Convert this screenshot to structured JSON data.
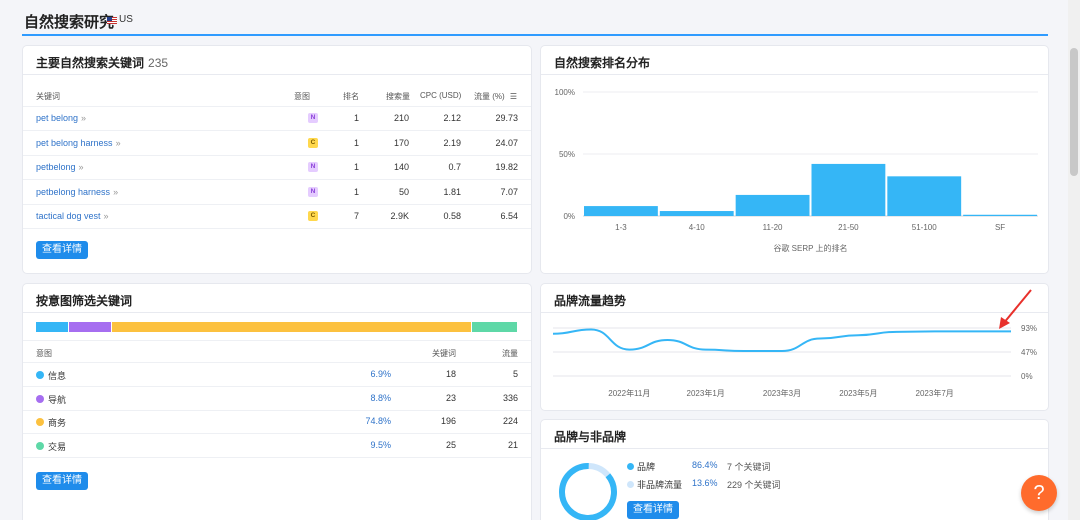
{
  "page": {
    "title": "自然搜索研究",
    "region": "US"
  },
  "keywords_card": {
    "title": "主要自然搜索关键词",
    "count": "235",
    "headers": {
      "keyword": "关键词",
      "intent": "意图",
      "rank": "排名",
      "volume": "搜索量",
      "cpc": "CPC (USD)",
      "traffic": "流量 (%)"
    },
    "rows": [
      {
        "keyword": "pet belong",
        "intent": "N",
        "rank": "1",
        "volume": "210",
        "cpc": "2.12",
        "traffic": "29.73"
      },
      {
        "keyword": "pet belong harness",
        "intent": "C",
        "rank": "1",
        "volume": "170",
        "cpc": "2.19",
        "traffic": "24.07"
      },
      {
        "keyword": "petbelong",
        "intent": "N",
        "rank": "1",
        "volume": "140",
        "cpc": "0.7",
        "traffic": "19.82"
      },
      {
        "keyword": "petbelong harness",
        "intent": "N",
        "rank": "1",
        "volume": "50",
        "cpc": "1.81",
        "traffic": "7.07"
      },
      {
        "keyword": "tactical dog vest",
        "intent": "C",
        "rank": "7",
        "volume": "2.9K",
        "cpc": "0.58",
        "traffic": "6.54"
      }
    ],
    "button": "查看详情"
  },
  "rank_card": {
    "title": "自然搜索排名分布"
  },
  "intent_card": {
    "title": "按意图筛选关键词",
    "headers": {
      "intent": "意图",
      "keywords": "关键词",
      "traffic": "流量"
    },
    "rows": [
      {
        "label": "信息",
        "pct": "6.9%",
        "pct_value": 6.9,
        "keywords": "18",
        "traffic": "5",
        "color": "#35b6f6"
      },
      {
        "label": "导航",
        "pct": "8.8%",
        "pct_value": 8.8,
        "keywords": "23",
        "traffic": "336",
        "color": "#a66ef0"
      },
      {
        "label": "商务",
        "pct": "74.8%",
        "pct_value": 74.8,
        "keywords": "196",
        "traffic": "224",
        "color": "#fcc13f"
      },
      {
        "label": "交易",
        "pct": "9.5%",
        "pct_value": 9.5,
        "keywords": "25",
        "traffic": "21",
        "color": "#5ed8a7"
      }
    ],
    "button": "查看详情"
  },
  "trend_card": {
    "title": "品牌流量趋势"
  },
  "brand_card": {
    "title": "品牌与非品牌",
    "brand": {
      "label": "品牌",
      "pct": "86.4%",
      "pct_value": 86.4,
      "keywords": "7 个关键词",
      "color": "#35b6f6"
    },
    "nonbrand": {
      "label": "非品牌流量",
      "pct": "13.6%",
      "pct_value": 13.6,
      "keywords": "229 个关键词",
      "color": "#cfe6fb"
    },
    "button": "查看详情"
  },
  "help": {
    "label": "?"
  },
  "chart_data": [
    {
      "type": "bar",
      "categories": [
        "1-3",
        "4-10",
        "11-20",
        "21-50",
        "51-100",
        "SF"
      ],
      "values": [
        8,
        4,
        17,
        42,
        32,
        1
      ],
      "xlabel": "谷歌 SERP 上的排名",
      "ylim": [
        0,
        100
      ],
      "y_ticks": [
        "0%",
        "50%",
        "100%"
      ],
      "color": "#35b6f6"
    },
    {
      "type": "line",
      "x": [
        "2022年9月",
        "2022年10月",
        "2022年11月",
        "2022年12月",
        "2023年1月",
        "2023年2月",
        "2023年3月",
        "2023年4月",
        "2023年5月",
        "2023年6月",
        "2023年7月",
        "2023年8月",
        "2023年9月"
      ],
      "x_tick_labels": [
        "2022年11月",
        "2023年1月",
        "2023年3月",
        "2023年5月",
        "2023年7月"
      ],
      "series": [
        {
          "values": [
            88,
            97,
            55,
            75,
            55,
            52,
            52,
            78,
            85,
            92,
            93,
            93,
            93
          ]
        }
      ],
      "y_ticks": [
        "0%",
        "47%",
        "93%"
      ],
      "ylim": [
        0,
        93
      ],
      "color": "#35b6f6"
    }
  ]
}
